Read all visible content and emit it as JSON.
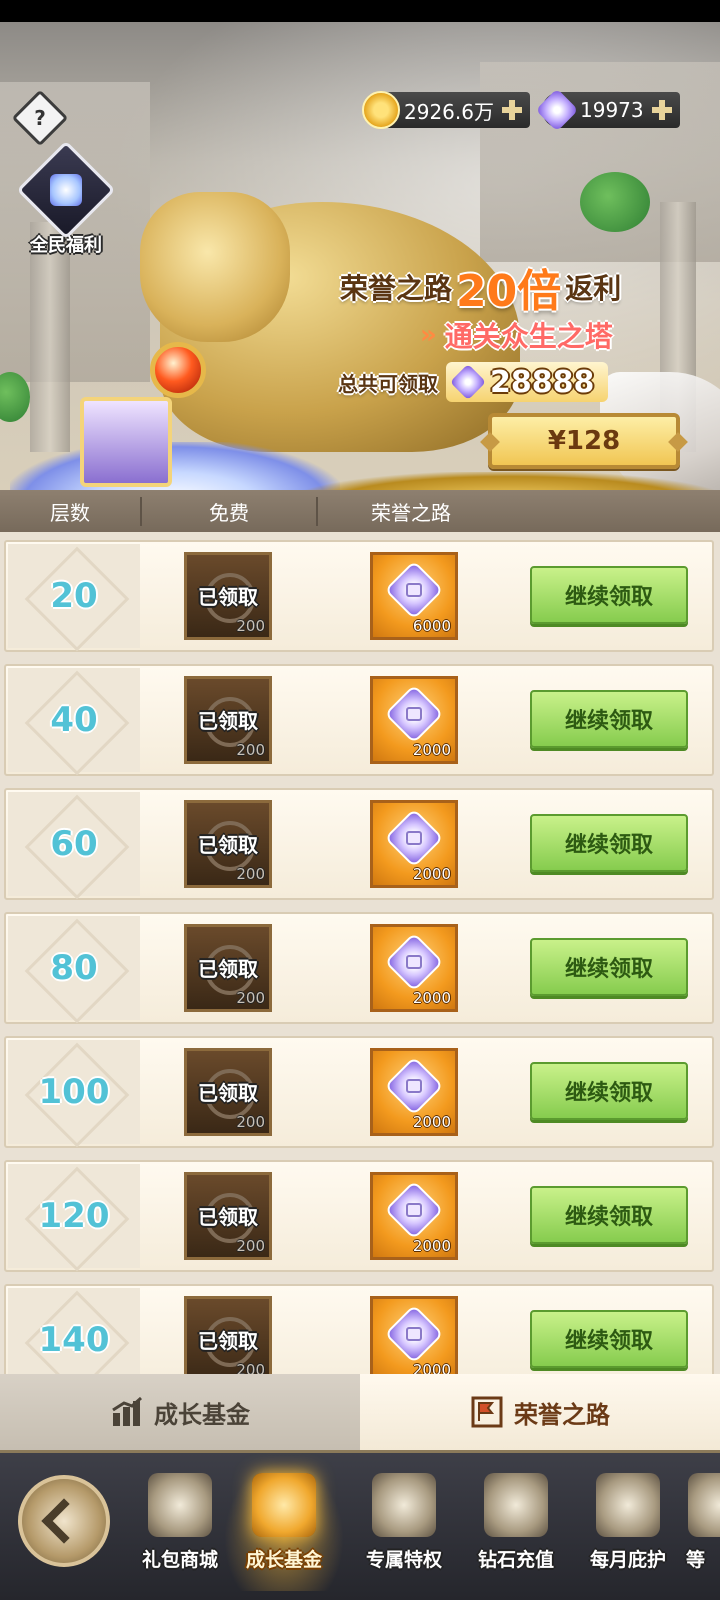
{
  "currency": {
    "gold": {
      "icon": "gold-coin-icon",
      "value": "2926.6万"
    },
    "diamond": {
      "icon": "diamond-icon",
      "value": "19973"
    }
  },
  "help": {
    "icon": "question-icon",
    "label": "?"
  },
  "welfare": {
    "icon": "gift-bag-icon",
    "label": "全民福利"
  },
  "banner": {
    "title_prefix": "荣誉之路",
    "multiplier": "20倍",
    "title_suffix": "返利",
    "subtitle_chevron": "»",
    "subtitle": "通关众生之塔",
    "total_label": "总共可领取",
    "total_value": "28888",
    "price": "¥128"
  },
  "table": {
    "headers": [
      "层数",
      "免费",
      "荣誉之路"
    ],
    "claimed_label": "已领取",
    "claim_button": "继续领取",
    "rows": [
      {
        "level": "20",
        "free_amount": "200",
        "honor_amount": "6000"
      },
      {
        "level": "40",
        "free_amount": "200",
        "honor_amount": "2000"
      },
      {
        "level": "60",
        "free_amount": "200",
        "honor_amount": "2000"
      },
      {
        "level": "80",
        "free_amount": "200",
        "honor_amount": "2000"
      },
      {
        "level": "100",
        "free_amount": "200",
        "honor_amount": "2000"
      },
      {
        "level": "120",
        "free_amount": "200",
        "honor_amount": "2000"
      },
      {
        "level": "140",
        "free_amount": "200",
        "honor_amount": "2000"
      }
    ]
  },
  "tabs": [
    {
      "label": "成长基金",
      "icon": "growth-chart-icon",
      "active": false
    },
    {
      "label": "荣誉之路",
      "icon": "honor-flag-icon",
      "active": true
    }
  ],
  "nav": [
    {
      "label": "礼包商城",
      "icon": "shop-icon",
      "active": false
    },
    {
      "label": "成长基金",
      "icon": "growth-fund-icon",
      "active": true
    },
    {
      "label": "专属特权",
      "icon": "privilege-icon",
      "active": false
    },
    {
      "label": "钻石充值",
      "icon": "diamond-recharge-icon",
      "active": false
    },
    {
      "label": "每月庇护",
      "icon": "monthly-shield-icon",
      "active": false
    },
    {
      "label": "等",
      "icon": "more-icon",
      "active": false
    }
  ],
  "colors": {
    "level_text": "#52c2d6",
    "claim_button": "#86cc4e",
    "honor_tile": "#f39a1e",
    "multiplier": "#ff7a1a",
    "subtitle": "#ff6a66"
  }
}
